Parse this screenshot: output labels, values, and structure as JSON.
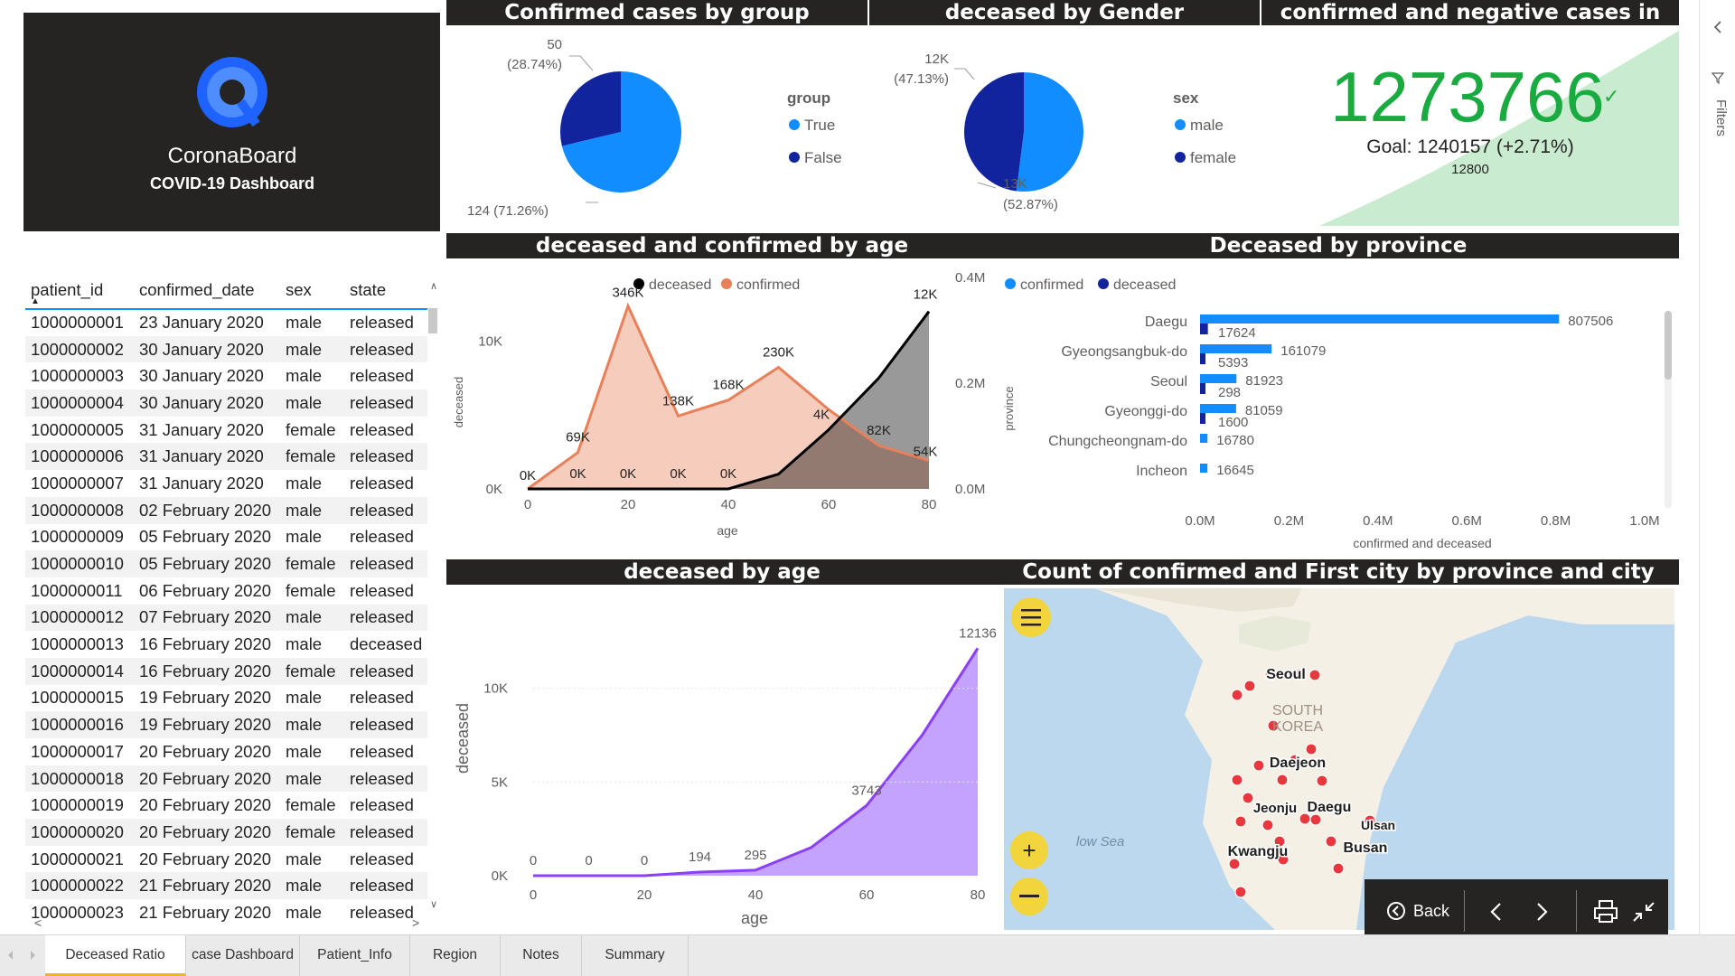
{
  "logo": {
    "name": "CoronaBoard",
    "subtitle": "COVID-19 Dashboard",
    "icon": "q-logo-icon"
  },
  "headers": {
    "transmission": "Confirmed cases by group Transmission",
    "gender": "deceased by Gender",
    "test": "confirmed and negative cases in test",
    "age_combo": "deceased and confirmed by age",
    "province": "Deceased by province",
    "deceased_age": "deceased by age",
    "map": "Count of confirmed and First city by province and city"
  },
  "transmission_pie": {
    "legend_title": "group",
    "legend": [
      "True",
      "False"
    ],
    "label_small": "50",
    "label_small_pct": "(28.74%)",
    "label_big": "124 (71.26%)",
    "colors": [
      "#118dff",
      "#12239e"
    ]
  },
  "gender_pie": {
    "legend_title": "sex",
    "legend": [
      "male",
      "female"
    ],
    "label_small": "12K",
    "label_small_pct": "(47.13%)",
    "label_big": "13K",
    "label_big_pct": "(52.87%)",
    "colors": [
      "#118dff",
      "#12239e"
    ]
  },
  "kpi": {
    "value": "1273766",
    "check": "✓",
    "goal": "Goal: 1240157 (+2.71%)",
    "minimum": "12800",
    "color": "#1aab40"
  },
  "table": {
    "columns": [
      "patient_id",
      "confirmed_date",
      "sex",
      "state"
    ],
    "rows": [
      [
        "1000000001",
        "23 January 2020",
        "male",
        "released"
      ],
      [
        "1000000002",
        "30 January 2020",
        "male",
        "released"
      ],
      [
        "1000000003",
        "30 January 2020",
        "male",
        "released"
      ],
      [
        "1000000004",
        "30 January 2020",
        "male",
        "released"
      ],
      [
        "1000000005",
        "31 January 2020",
        "female",
        "released"
      ],
      [
        "1000000006",
        "31 January 2020",
        "female",
        "released"
      ],
      [
        "1000000007",
        "31 January 2020",
        "male",
        "released"
      ],
      [
        "1000000008",
        "02 February 2020",
        "male",
        "released"
      ],
      [
        "1000000009",
        "05 February 2020",
        "male",
        "released"
      ],
      [
        "1000000010",
        "05 February 2020",
        "female",
        "released"
      ],
      [
        "1000000011",
        "06 February 2020",
        "female",
        "released"
      ],
      [
        "1000000012",
        "07 February 2020",
        "male",
        "released"
      ],
      [
        "1000000013",
        "16 February 2020",
        "male",
        "deceased"
      ],
      [
        "1000000014",
        "16 February 2020",
        "female",
        "released"
      ],
      [
        "1000000015",
        "19 February 2020",
        "male",
        "released"
      ],
      [
        "1000000016",
        "19 February 2020",
        "male",
        "released"
      ],
      [
        "1000000017",
        "20 February 2020",
        "male",
        "released"
      ],
      [
        "1000000018",
        "20 February 2020",
        "male",
        "released"
      ],
      [
        "1000000019",
        "20 February 2020",
        "female",
        "released"
      ],
      [
        "1000000020",
        "20 February 2020",
        "female",
        "released"
      ],
      [
        "1000000021",
        "20 February 2020",
        "male",
        "released"
      ],
      [
        "1000000022",
        "21 February 2020",
        "male",
        "released"
      ],
      [
        "1000000023",
        "21 February 2020",
        "male",
        "released"
      ]
    ]
  },
  "age_combo": {
    "legend": [
      "deceased",
      "confirmed"
    ],
    "colors": [
      "#000000",
      "#e8805a"
    ],
    "xlabel": "age",
    "ylabel": "deceased",
    "x_ticks": [
      "0",
      "20",
      "40",
      "60",
      "80"
    ],
    "y_left_ticks": [
      "0K",
      "10K"
    ],
    "y_right_ticks": [
      "0.0M",
      "0.2M",
      "0.4M"
    ],
    "confirmed_labels": [
      "0K",
      "69K",
      "346K",
      "138K",
      "168K",
      "230K",
      "82K",
      "54K"
    ],
    "deceased_labels": [
      "0K",
      "0K",
      "0K",
      "0K",
      "4K",
      "12K"
    ]
  },
  "province": {
    "legend": [
      "confirmed",
      "deceased"
    ],
    "colors": [
      "#118dff",
      "#12239e"
    ],
    "ylabel": "province",
    "xlabel": "confirmed and deceased",
    "x_ticks": [
      "0.0M",
      "0.2M",
      "0.4M",
      "0.6M",
      "0.8M",
      "1.0M"
    ],
    "rows": [
      {
        "name": "Daegu",
        "confirmed_label": "807506",
        "deceased_label": "17624"
      },
      {
        "name": "Gyeongsangbuk-do",
        "confirmed_label": "161079",
        "deceased_label": "5393"
      },
      {
        "name": "Seoul",
        "confirmed_label": "81923",
        "deceased_label": "298"
      },
      {
        "name": "Gyeonggi-do",
        "confirmed_label": "81059",
        "deceased_label": "1600"
      },
      {
        "name": "Chungcheongnam-do",
        "confirmed_label": "16780",
        "deceased_label": ""
      },
      {
        "name": "Incheon",
        "confirmed_label": "16645",
        "deceased_label": ""
      }
    ]
  },
  "deceased_age": {
    "xlabel": "age",
    "ylabel": "deceased",
    "x_ticks": [
      "0",
      "20",
      "40",
      "60",
      "80"
    ],
    "y_ticks": [
      "0K",
      "5K",
      "10K"
    ],
    "point_labels": [
      "0",
      "0",
      "0",
      "194",
      "295",
      "3743",
      "12136"
    ],
    "color": "#b388ff"
  },
  "map": {
    "cities": [
      "Seoul",
      "Daejeon",
      "Jeonju",
      "Daegu",
      "Ulsan",
      "Kwangju",
      "Busan"
    ],
    "country_label": [
      "SOUTH",
      "KOREA"
    ],
    "sea_label": "low Sea",
    "marker_color": "#e8383d"
  },
  "navbar": {
    "back": "Back"
  },
  "side": {
    "filters": "Filters"
  },
  "tabs": [
    "Deceased Ratio",
    "case Dashboard",
    "Patient_Info",
    "Region",
    "Notes",
    "Summary"
  ],
  "chart_data": [
    {
      "type": "pie",
      "title": "Confirmed cases by group Transmission",
      "categories": [
        "True",
        "False"
      ],
      "values": [
        124,
        50
      ],
      "legend": "group"
    },
    {
      "type": "pie",
      "title": "deceased by Gender",
      "categories": [
        "male",
        "female"
      ],
      "values": [
        13000,
        12000
      ],
      "legend": "sex"
    },
    {
      "type": "area",
      "title": "deceased and confirmed by age",
      "x": [
        0,
        10,
        20,
        30,
        40,
        50,
        60,
        70,
        80
      ],
      "xlabel": "age",
      "ylabel": "deceased",
      "series": [
        {
          "name": "confirmed",
          "values": [
            0,
            69000,
            346000,
            138000,
            168000,
            230000,
            150000,
            82000,
            54000
          ],
          "axis": "right"
        },
        {
          "name": "deceased",
          "values": [
            0,
            0,
            0,
            0,
            0,
            1000,
            4000,
            7500,
            12000
          ],
          "axis": "left"
        }
      ],
      "ylim_left": [
        0,
        14000
      ],
      "ylim_right": [
        0,
        0.4
      ]
    },
    {
      "type": "bar",
      "title": "Deceased by province",
      "categories": [
        "Daegu",
        "Gyeongsangbuk-do",
        "Seoul",
        "Gyeonggi-do",
        "Chungcheongnam-do",
        "Incheon"
      ],
      "series": [
        {
          "name": "confirmed",
          "values": [
            807506,
            161079,
            81923,
            81059,
            16780,
            16645
          ]
        },
        {
          "name": "deceased",
          "values": [
            17624,
            5393,
            298,
            1600,
            0,
            0
          ]
        }
      ],
      "xlabel": "confirmed and deceased",
      "ylabel": "province",
      "xlim": [
        0,
        1000000
      ]
    },
    {
      "type": "area",
      "title": "deceased by age",
      "x": [
        0,
        10,
        20,
        30,
        40,
        50,
        60,
        70,
        80
      ],
      "values": [
        0,
        0,
        0,
        194,
        295,
        1500,
        3743,
        7500,
        12136
      ],
      "xlabel": "age",
      "ylabel": "deceased",
      "ylim": [
        0,
        13500
      ]
    }
  ]
}
